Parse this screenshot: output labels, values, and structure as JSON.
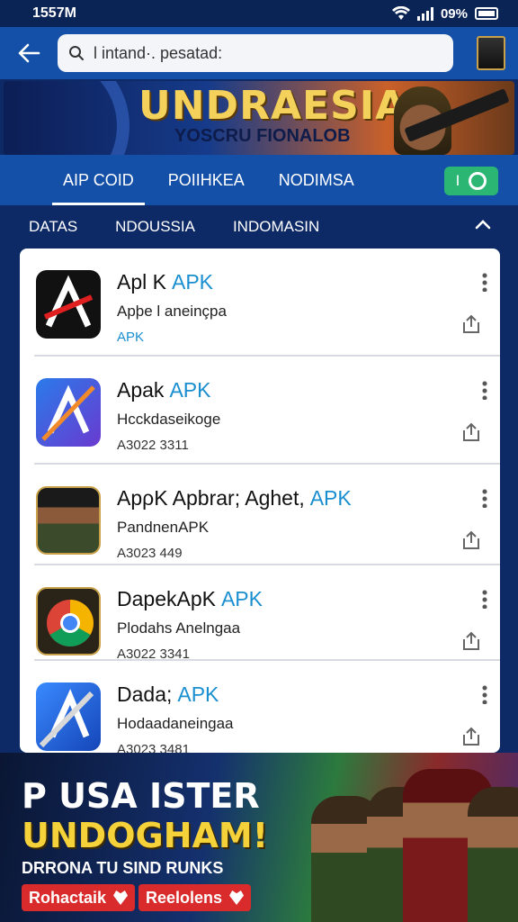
{
  "status": {
    "time": "1557M",
    "battery_text": "09%"
  },
  "search": {
    "value": "l intand·. pesatad:"
  },
  "banner": {
    "title": "UNDRAESIA",
    "subtitle": "YOSCRU FIONALOB"
  },
  "tabs": {
    "items": [
      "AIP COID",
      "POIIHKEA",
      "NODIMSA"
    ],
    "action_label": "I"
  },
  "filters": [
    "DATAS",
    "NDOUSSIA",
    "INDOMASIN"
  ],
  "apps": [
    {
      "name": "Apl K",
      "tag": "APK",
      "subtitle": "Apþe l aneinçpa",
      "meta": "APK",
      "meta_style": "blue"
    },
    {
      "name": "Apak",
      "tag": "APK",
      "subtitle": "Hcckdaseikoge",
      "meta": "A3022 3311",
      "meta_style": "plain"
    },
    {
      "name": "ApρK Apbrar; Aghet,",
      "tag": "APK",
      "subtitle": "PandnenAPK",
      "meta": "A3023 449",
      "meta_style": "plain"
    },
    {
      "name": "DapekApK",
      "tag": "APK",
      "subtitle": "Plodahs Anelngaa",
      "meta": "A3022 3341",
      "meta_style": "plain"
    },
    {
      "name": "Dada;",
      "tag": "APK",
      "subtitle": "Hodaadaneingaa",
      "meta": "A3023 3481",
      "meta_style": "plain"
    }
  ],
  "bottom_banner": {
    "line1": "P USA ISTER",
    "line2": "UNDOGHAM!",
    "line3": "DRRONA TU SIND RUNKS",
    "button1": "Rohactaik",
    "button2": "Reelolens"
  },
  "colors": {
    "primary": "#1450a8",
    "accent_green": "#2bb673",
    "tag_blue": "#1a8fd0",
    "promo_red": "#d92b2b"
  }
}
